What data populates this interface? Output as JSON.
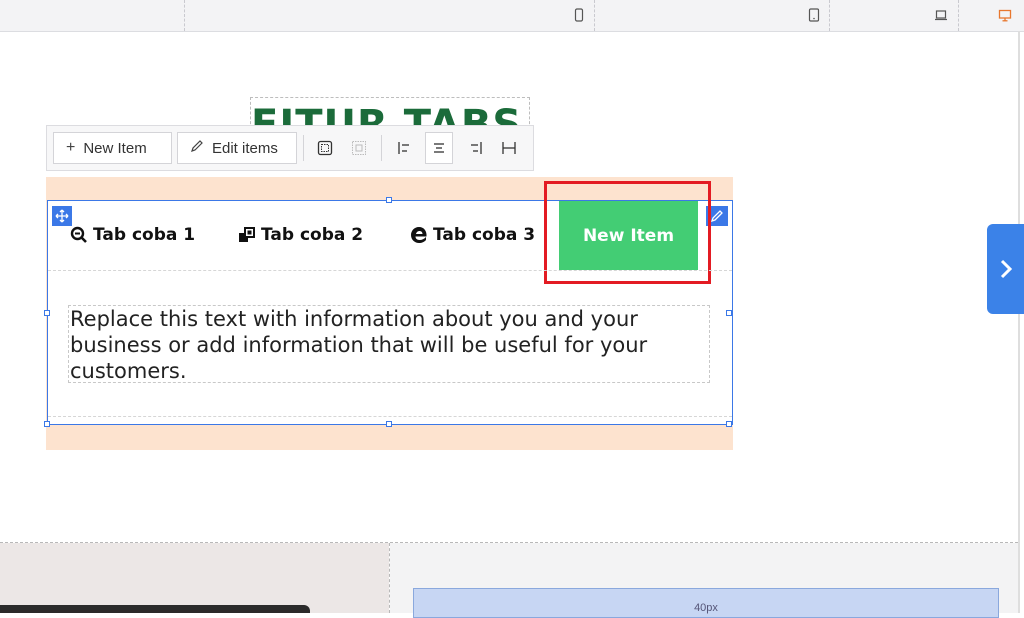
{
  "toolbar": {
    "new_item_label": "New Item",
    "edit_items_label": "Edit items"
  },
  "page": {
    "heading": "FITUR TABS"
  },
  "tabs": [
    {
      "label": "Tab coba 1",
      "icon": "search-minus-icon"
    },
    {
      "label": "Tab coba 2",
      "icon": "clone-icon"
    },
    {
      "label": "Tab coba 3",
      "icon": "edge-icon"
    },
    {
      "label": "New Item",
      "active": true
    }
  ],
  "content": {
    "text": "Replace this text with information about you and your business or add information that will be useful for your customers."
  },
  "spacer": {
    "label": "40px"
  },
  "colors": {
    "accent": "#3b78e7",
    "tab_active": "#43cd74",
    "highlight": "#e31b23",
    "section_bg": "#fde3cf",
    "heading": "#1b6b3a"
  }
}
